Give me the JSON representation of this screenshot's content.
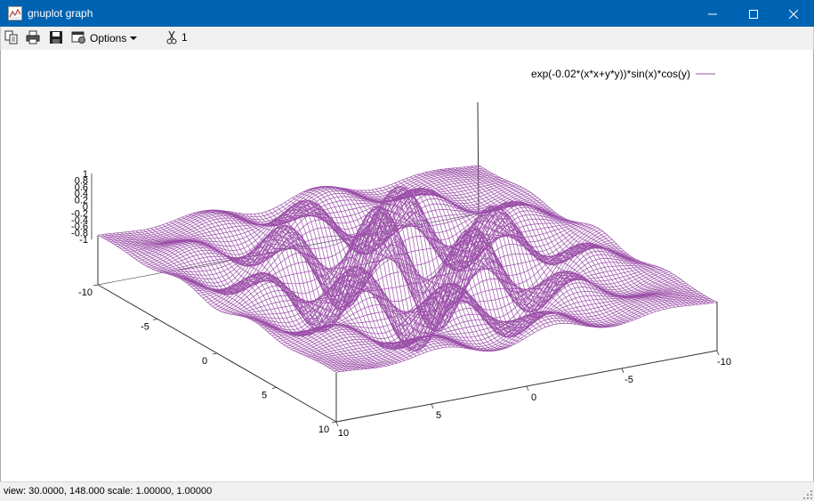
{
  "window": {
    "title": "gnuplot graph",
    "minimize": "—",
    "maximize": "☐",
    "close": "✕"
  },
  "toolbar": {
    "icons": [
      "copy-icon",
      "print-icon",
      "save-icon",
      "options-icon",
      "grid-icon"
    ],
    "options_label": "Options",
    "grid_count": "1"
  },
  "chart_data": {
    "type": "surface",
    "function": "exp(-0.02*(x*x+y*y))*sin(x)*cos(y)",
    "legend_label": "exp(-0.02*(x*x+y*y))*sin(x)*cos(y)",
    "legend_position": "top-right",
    "color": "#9b4fa8",
    "view": {
      "rot_x": 30,
      "rot_z": 148,
      "scale": 1,
      "scale_z": 1
    },
    "x_range": [
      -10,
      10
    ],
    "y_range": [
      -10,
      10
    ],
    "z_range": [
      -1,
      1
    ],
    "x_ticks": [
      -10,
      -5,
      0,
      5,
      10
    ],
    "y_ticks": [
      -10,
      -5,
      0,
      5,
      10
    ],
    "z_ticks": [
      "1",
      "0.8",
      "0.6",
      "0.4",
      "0.2",
      "0",
      "-0.2",
      "-0.4",
      "-0.6",
      "-0.8",
      "-1"
    ],
    "samples": 100
  },
  "status": {
    "text": "view:  30.0000,  148.000   scale:  1.00000,  1.00000"
  }
}
